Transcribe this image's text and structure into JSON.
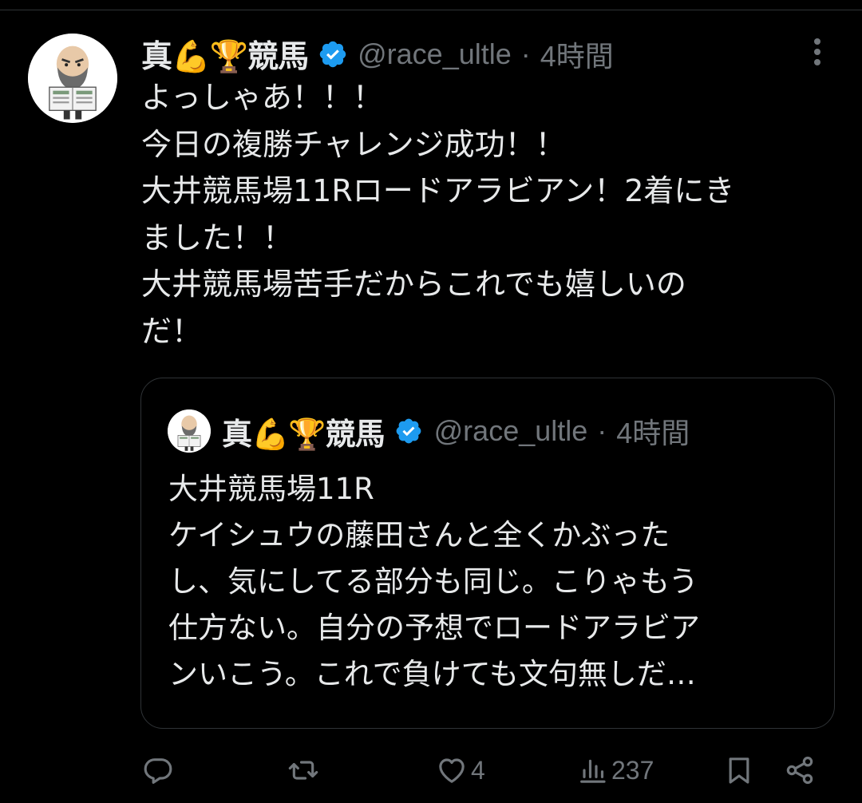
{
  "tweet": {
    "display_name": "真💪🏆競馬",
    "handle": "@race_ultle",
    "separator": "·",
    "time": "4時間",
    "lines": [
      "よっしゃあ！！！",
      "今日の複勝チャレンジ成功！！",
      "大井競馬場11Rロードアラビアン！2着にき",
      "ました！！",
      "大井競馬場苦手だからこれでも嬉しいの",
      "だ！"
    ]
  },
  "quoted_tweet": {
    "display_name": "真💪🏆競馬",
    "handle": "@race_ultle",
    "separator": "·",
    "time": "4時間",
    "lines": [
      "大井競馬場11R",
      "ケイシュウの藤田さんと全くかぶった",
      "し、気にしてる部分も同じ。こりゃもう",
      "仕方ない。自分の予想でロードアラビア",
      "ンいこう。これで負けても文句無しだ…"
    ]
  },
  "actions": {
    "reply_count": "",
    "retweet_count": "",
    "like_count": "4",
    "view_count": "237"
  },
  "icons": {
    "verified": "verified-badge-icon",
    "more": "more-icon",
    "reply": "reply-icon",
    "retweet": "retweet-icon",
    "like": "heart-icon",
    "views": "views-icon",
    "bookmark": "bookmark-icon",
    "share": "share-icon"
  },
  "colors": {
    "background": "#000000",
    "text": "#e7e9ea",
    "muted": "#71767b",
    "border": "#2f3336",
    "verified": "#1d9bf0"
  }
}
